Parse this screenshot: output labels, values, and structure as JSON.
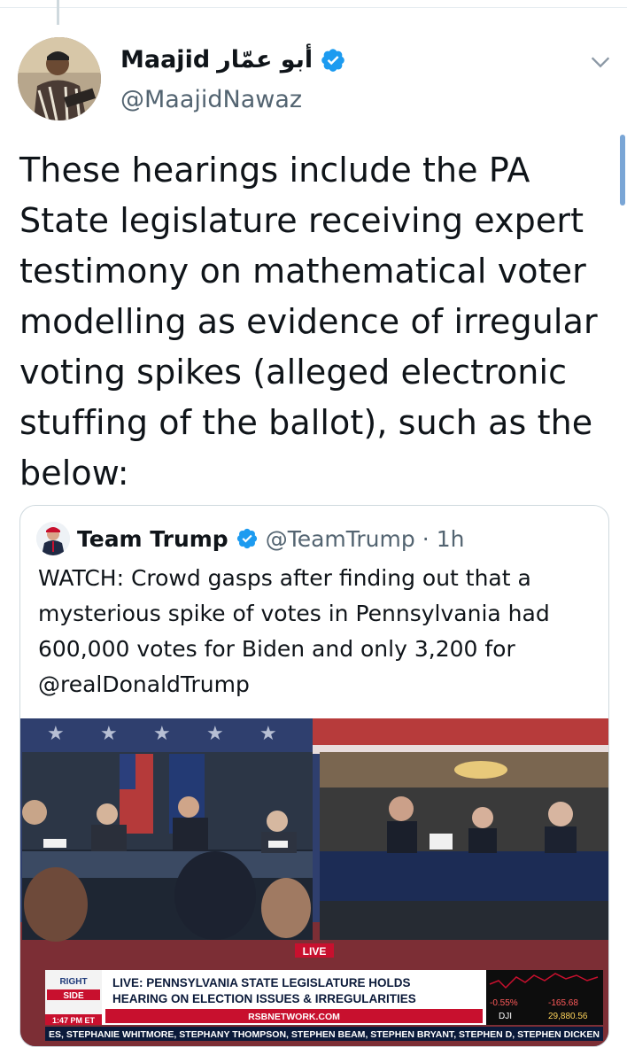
{
  "author": {
    "name": "Maajid",
    "name_arabic": "أبو عمّار",
    "handle": "@MaajidNawaz",
    "verified": true
  },
  "tweet": {
    "text": "These hearings include the PA State legislature receiving expert testimony on mathematical voter modelling as evidence of irregular voting spikes (alleged electronic stuffing of the ballot), such as the below:"
  },
  "quoted": {
    "name": "Team Trump",
    "handle": "@TeamTrump",
    "separator": "·",
    "time": "1h",
    "verified": true,
    "text": "WATCH: Crowd gasps after finding out that a mysterious spike of votes in Pennsylvania had 600,000 votes for Biden and only 3,200 for @realDonaldTrump"
  },
  "video": {
    "live_badge": "LIVE",
    "show_logo_line1": "RIGHT",
    "show_logo_line2": "SIDE",
    "time": "1:47 PM ET",
    "headline_line1": "LIVE: PENNSYLVANIA STATE LEGISLATURE HOLDS",
    "headline_line2": "HEARING ON ELECTION ISSUES & IRREGULARITIES",
    "network": "RSBNETWORK.COM",
    "ticker_pct": "-0.55%",
    "ticker_change": "-165.68",
    "ticker_index": "DJI",
    "ticker_value": "29,880.56",
    "crawl": "ES, STEPHANIE WHITMORE, STEPHANY THOMPSON, STEPHEN BEAM, STEPHEN BRYANT, STEPHEN D, STEPHEN DICKEN"
  },
  "colors": {
    "verified": "#1d9bf0",
    "secondary_text": "#536471",
    "chyron_red": "#c8102e",
    "ticker_green": "#2ecc71"
  },
  "icons": {
    "verified": "verified-badge-icon",
    "menu": "chevron-down-icon"
  }
}
